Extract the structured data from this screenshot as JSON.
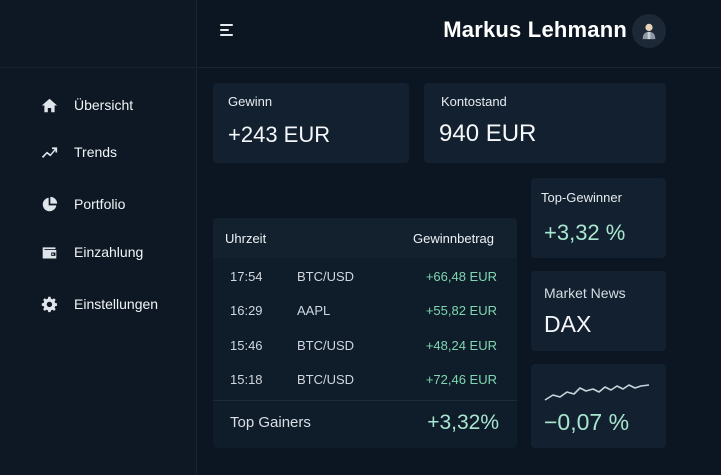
{
  "sidebar": {
    "items": [
      {
        "label": "Übersicht",
        "icon": "home-icon"
      },
      {
        "label": "Trends",
        "icon": "trend-icon"
      },
      {
        "label": "Portfolio",
        "icon": "pie-chart-icon"
      },
      {
        "label": "Einzahlung",
        "icon": "wallet-icon"
      },
      {
        "label": "Einstellungen",
        "icon": "gear-icon"
      }
    ]
  },
  "header": {
    "user_name": "Markus Lehmann"
  },
  "cards": {
    "gewinn": {
      "label": "Gewinn",
      "value": "+243 EUR"
    },
    "kontostand": {
      "label": "Kontostand",
      "value": "940 EUR"
    },
    "top_gewinner": {
      "label": "Top-Gewinner",
      "value": "+3,32 %"
    },
    "market_news": {
      "label": "Market News",
      "value": "DAX"
    },
    "index_change": {
      "value": "−0,07 %"
    }
  },
  "table": {
    "headers": {
      "time": "Uhrzeit",
      "amount": "Gewinnbetrag"
    },
    "rows": [
      {
        "time": "17:54",
        "asset": "BTC/USD",
        "amount": "+66,48 EUR"
      },
      {
        "time": "16:29",
        "asset": "AAPL",
        "amount": "+55,82 EUR"
      },
      {
        "time": "15:46",
        "asset": "BTC/USD",
        "amount": "+48,24 EUR"
      },
      {
        "time": "15:18",
        "asset": "BTC/USD",
        "amount": "+72,46 EUR"
      }
    ],
    "footer": {
      "label": "Top Gainers",
      "value": "+3,32%"
    }
  },
  "colors": {
    "background": "#0c1622",
    "card": "#12202f",
    "positive": "#7fd6b0",
    "accent_value": "#a8e6d0"
  }
}
